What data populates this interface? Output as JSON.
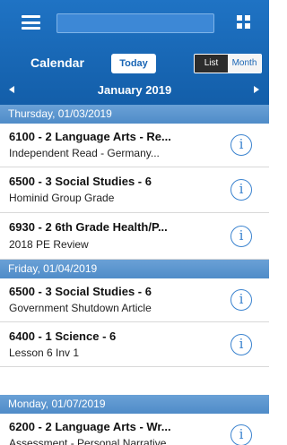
{
  "header": {
    "search_value": "",
    "calendar_label": "Calendar",
    "today_label": "Today",
    "view_toggle": {
      "list_label": "List",
      "month_label": "Month",
      "selected": "List"
    },
    "month_title": "January 2019"
  },
  "days": [
    {
      "date_label": "Thursday, 01/03/2019",
      "items": [
        {
          "title": "6100 - 2 Language Arts - Re...",
          "subtitle": "Independent Read - Germany..."
        },
        {
          "title": "6500 - 3 Social Studies - 6",
          "subtitle": "Hominid Group Grade"
        },
        {
          "title": "6930 - 2 6th Grade Health/P...",
          "subtitle": "2018 PE Review"
        }
      ]
    },
    {
      "date_label": "Friday, 01/04/2019",
      "items": [
        {
          "title": "6500 - 3 Social Studies - 6",
          "subtitle": "Government Shutdown Article"
        },
        {
          "title": "6400 - 1 Science - 6",
          "subtitle": "Lesson 6 Inv 1"
        }
      ]
    },
    {
      "date_label": "Monday, 01/07/2019",
      "items": [
        {
          "title": "6200 - 2 Language Arts - Wr...",
          "subtitle": "Assessment - Personal Narrative"
        }
      ]
    }
  ],
  "info_glyph": "i",
  "colors": {
    "header_blue": "#1a66b5",
    "day_bar": "#5b95cd",
    "info_blue": "#3b83cf"
  }
}
